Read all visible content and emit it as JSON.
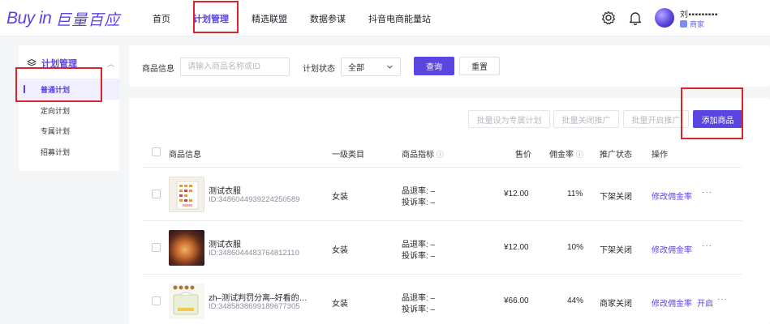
{
  "brand": {
    "logo_en": "Buy in",
    "logo_cn": "巨量百应"
  },
  "nav": {
    "items": [
      {
        "label": "首页",
        "active": false
      },
      {
        "label": "计划管理",
        "active": true
      },
      {
        "label": "精选联盟",
        "active": false
      },
      {
        "label": "数据参谋",
        "active": false
      },
      {
        "label": "抖音电商能量站",
        "active": false
      }
    ]
  },
  "user": {
    "name": "刘▪▪▪▪▪▪▪▪▪",
    "role": "商家"
  },
  "sidebar": {
    "section_label": "计划管理",
    "items": [
      {
        "label": "普通计划",
        "active": true
      },
      {
        "label": "定向计划",
        "active": false
      },
      {
        "label": "专属计划",
        "active": false
      },
      {
        "label": "招募计划",
        "active": false
      }
    ]
  },
  "filter": {
    "product_label": "商品信息",
    "product_placeholder": "请输入商品名称或ID",
    "status_label": "计划状态",
    "status_value": "全部",
    "query_button": "查询",
    "reset_button": "重置"
  },
  "actions": {
    "batch_exclusive": "批量设为专属计划",
    "batch_close": "批量关闭推广",
    "batch_open": "批量开启推广",
    "add_product": "添加商品"
  },
  "table": {
    "headers": {
      "product": "商品信息",
      "category": "一级类目",
      "metrics": "商品指标",
      "price": "售价",
      "commission": "佣金率",
      "status": "推广状态",
      "operation": "操作"
    },
    "rows": [
      {
        "name": "测试衣服",
        "id": "ID:3486044939224250589",
        "category": "女装",
        "refund": "品退率: –",
        "complaint": "投诉率: –",
        "price": "¥12.00",
        "commission": "11%",
        "status": "下架关闭",
        "op_main": "修改佣金率",
        "op_extra": "",
        "op_more": "···"
      },
      {
        "name": "测试衣服",
        "id": "ID:3486044483764812110",
        "category": "女装",
        "refund": "品退率: –",
        "complaint": "投诉率: –",
        "price": "¥12.00",
        "commission": "10%",
        "status": "下架关闭",
        "op_main": "修改佣金率",
        "op_extra": "",
        "op_more": "···"
      },
      {
        "name": "zh–测试判罚分离–好看的…",
        "id": "ID:3485838699189677305",
        "category": "女装",
        "refund": "品退率: –",
        "complaint": "投诉率: –",
        "price": "¥66.00",
        "commission": "44%",
        "status": "商家关闭",
        "op_main": "修改佣金率",
        "op_extra": "开启",
        "op_more": "···"
      }
    ]
  },
  "colors": {
    "accent": "#5a45e0",
    "highlight_box": "#d9252b"
  }
}
